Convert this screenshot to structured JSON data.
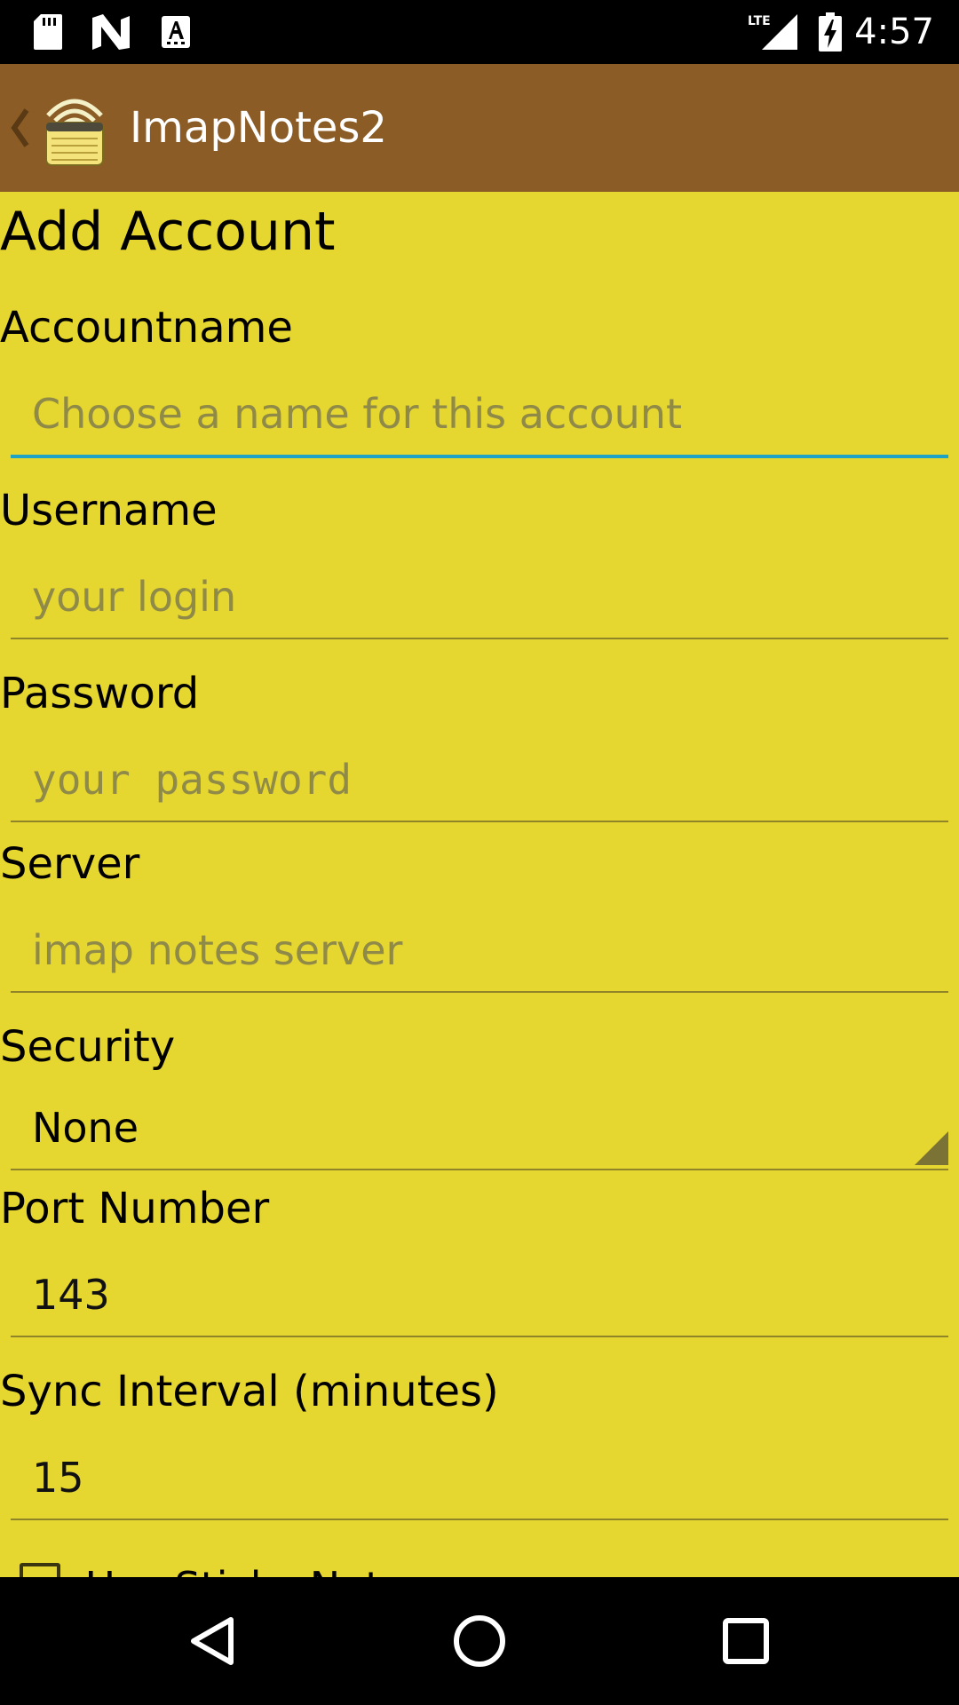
{
  "status_bar": {
    "time": "4:57",
    "network": "LTE",
    "icons": [
      "sd-card-icon",
      "n-notification-icon",
      "keyboard-a-icon",
      "lte-signal-icon",
      "battery-charging-icon"
    ]
  },
  "action_bar": {
    "title": "ImapNotes2",
    "icons": [
      "back-chevron-icon",
      "app-notepad-icon"
    ],
    "background": "#8b5c25"
  },
  "form": {
    "heading": "Add Account",
    "accountname": {
      "label": "Accountname",
      "value": "",
      "placeholder": "Choose a name for this account"
    },
    "username": {
      "label": "Username",
      "value": "",
      "placeholder": "your login"
    },
    "password": {
      "label": "Password",
      "value": "",
      "placeholder": "your password"
    },
    "server": {
      "label": "Server",
      "value": "",
      "placeholder": "imap notes server"
    },
    "security": {
      "label": "Security",
      "selected": "None"
    },
    "port": {
      "label": "Port Number",
      "value": "143"
    },
    "sync_interval": {
      "label": "Sync Interval (minutes)",
      "value": "15"
    },
    "sticky_notes": {
      "label": "Use Sticky Notes",
      "checked": false
    }
  },
  "nav_bar": {
    "icons": [
      "back-triangle-icon",
      "home-circle-icon",
      "recents-square-icon"
    ]
  },
  "colors": {
    "background": "#e6d630",
    "focus_accent": "#1ea3c4",
    "hint_text": "#8f8a47"
  }
}
